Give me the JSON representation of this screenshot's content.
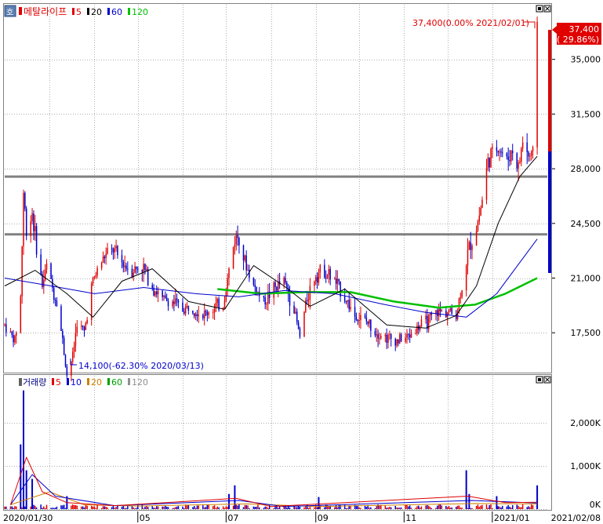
{
  "price_panel": {
    "icon_label": "호",
    "stock_name": "메탈라이프",
    "ma_legend": [
      {
        "label": "5",
        "color": "#e00000"
      },
      {
        "label": "20",
        "color": "#000000"
      },
      {
        "label": "60",
        "color": "#0000cc"
      },
      {
        "label": "120",
        "color": "#00c000"
      }
    ],
    "high_annotation": "37,400(0.00% 2021/02/01)",
    "low_annotation": "14,100(-62.30% 2020/03/13)",
    "current_price_label": "37,400",
    "current_change_label": "( 29.86%)",
    "y_ticks": [
      "35,000",
      "31,500",
      "28,000",
      "24,500",
      "21,000",
      "17,500"
    ]
  },
  "volume_panel": {
    "title": "거래량",
    "ma_legend": [
      {
        "label": "5",
        "color": "#e00000"
      },
      {
        "label": "10",
        "color": "#0000cc"
      },
      {
        "label": "20",
        "color": "#d08000"
      },
      {
        "label": "60",
        "color": "#00a000"
      },
      {
        "label": "120",
        "color": "#909090"
      }
    ],
    "y_ticks": [
      "2,000K",
      "1,000K",
      "0K"
    ]
  },
  "x_axis": {
    "labels": [
      "2020/01/30",
      "05",
      "07",
      "09",
      "11",
      "2021/01",
      "2021/02/08"
    ]
  },
  "colors": {
    "up": "#e00000",
    "down": "#0000cc",
    "ma5": "#e00000",
    "ma20": "#000000",
    "ma60": "#0000cc",
    "ma120": "#00c000",
    "grid": "#b0b0b0",
    "support_line": "#808080"
  },
  "chart_data": {
    "type": "candlestick",
    "x_start": "2020/01/30",
    "x_end": "2021/02/08",
    "ylim": [
      15000,
      38500
    ],
    "volume_ylim": [
      0,
      2800000
    ],
    "horizontal_lines": [
      27500,
      23800
    ],
    "price_path": [
      [
        "2020/01/30",
        18000
      ],
      [
        "2020/02/03",
        17400
      ],
      [
        "2020/02/06",
        17000
      ],
      [
        "2020/02/10",
        19800
      ],
      [
        "2020/02/12",
        26500
      ],
      [
        "2020/02/14",
        24000
      ],
      [
        "2020/02/18",
        25200
      ],
      [
        "2020/02/21",
        23000
      ],
      [
        "2020/02/25",
        20500
      ],
      [
        "2020/02/28",
        21800
      ],
      [
        "2020/03/04",
        20000
      ],
      [
        "2020/03/06",
        19500
      ],
      [
        "2020/03/10",
        17000
      ],
      [
        "2020/03/13",
        14800
      ],
      [
        "2020/03/17",
        16000
      ],
      [
        "2020/03/20",
        18200
      ],
      [
        "2020/03/25",
        17500
      ],
      [
        "2020/03/30",
        20500
      ],
      [
        "2020/04/03",
        21500
      ],
      [
        "2020/04/08",
        22400
      ],
      [
        "2020/04/14",
        22800
      ],
      [
        "2020/04/20",
        22000
      ],
      [
        "2020/04/27",
        21500
      ],
      [
        "2020/05/04",
        21800
      ],
      [
        "2020/05/11",
        20500
      ],
      [
        "2020/05/18",
        19600
      ],
      [
        "2020/05/25",
        19500
      ],
      [
        "2020/06/01",
        19000
      ],
      [
        "2020/06/08",
        19200
      ],
      [
        "2020/06/15",
        18600
      ],
      [
        "2020/06/22",
        19100
      ],
      [
        "2020/06/29",
        19300
      ],
      [
        "2020/07/03",
        21500
      ],
      [
        "2020/07/07",
        23500
      ],
      [
        "2020/07/10",
        23800
      ],
      [
        "2020/07/14",
        22000
      ],
      [
        "2020/07/20",
        20500
      ],
      [
        "2020/07/27",
        19500
      ],
      [
        "2020/08/03",
        20300
      ],
      [
        "2020/08/10",
        20800
      ],
      [
        "2020/08/17",
        19000
      ],
      [
        "2020/08/21",
        17200
      ],
      [
        "2020/08/26",
        19800
      ],
      [
        "2020/09/01",
        21300
      ],
      [
        "2020/09/07",
        21500
      ],
      [
        "2020/09/14",
        20800
      ],
      [
        "2020/09/21",
        19800
      ],
      [
        "2020/09/28",
        18600
      ],
      [
        "2020/10/06",
        18200
      ],
      [
        "2020/10/13",
        17600
      ],
      [
        "2020/10/20",
        17200
      ],
      [
        "2020/10/27",
        17000
      ],
      [
        "2020/11/03",
        17200
      ],
      [
        "2020/11/10",
        17800
      ],
      [
        "2020/11/17",
        18200
      ],
      [
        "2020/11/24",
        18800
      ],
      [
        "2020/12/01",
        18900
      ],
      [
        "2020/12/07",
        18600
      ],
      [
        "2020/12/11",
        20500
      ],
      [
        "2020/12/16",
        23000
      ],
      [
        "2020/12/21",
        24200
      ],
      [
        "2020/12/24",
        25500
      ],
      [
        "2020/12/29",
        28500
      ],
      [
        "2021/01/05",
        29500
      ],
      [
        "2021/01/11",
        28500
      ],
      [
        "2021/01/15",
        29200
      ],
      [
        "2021/01/19",
        28000
      ],
      [
        "2021/01/22",
        29800
      ],
      [
        "2021/01/26",
        28800
      ],
      [
        "2021/01/29",
        28800
      ],
      [
        "2021/02/01",
        37400
      ]
    ],
    "ma20": [
      [
        "2020/01/30",
        20500
      ],
      [
        "2020/02/20",
        21500
      ],
      [
        "2020/03/13",
        20000
      ],
      [
        "2020/03/31",
        18500
      ],
      [
        "2020/04/20",
        20800
      ],
      [
        "2020/05/11",
        21600
      ],
      [
        "2020/06/05",
        19500
      ],
      [
        "2020/06/30",
        19000
      ],
      [
        "2020/07/20",
        21800
      ],
      [
        "2020/08/10",
        20500
      ],
      [
        "2020/08/28",
        19200
      ],
      [
        "2020/09/21",
        20300
      ],
      [
        "2020/10/20",
        18000
      ],
      [
        "2020/11/16",
        17800
      ],
      [
        "2020/12/07",
        18600
      ],
      [
        "2020/12/21",
        20500
      ],
      [
        "2021/01/05",
        24500
      ],
      [
        "2021/01/20",
        27500
      ],
      [
        "2021/02/01",
        28800
      ]
    ],
    "ma60": [
      [
        "2020/01/30",
        21000
      ],
      [
        "2020/03/02",
        20500
      ],
      [
        "2020/04/01",
        20000
      ],
      [
        "2020/05/05",
        20400
      ],
      [
        "2020/06/10",
        20000
      ],
      [
        "2020/07/10",
        19800
      ],
      [
        "2020/08/10",
        20200
      ],
      [
        "2020/09/14",
        20000
      ],
      [
        "2020/10/19",
        19300
      ],
      [
        "2020/11/16",
        18800
      ],
      [
        "2020/12/14",
        18500
      ],
      [
        "2021/01/04",
        20000
      ],
      [
        "2021/02/01",
        23500
      ]
    ],
    "ma120": [
      [
        "2020/06/25",
        20300
      ],
      [
        "2020/07/25",
        20000
      ],
      [
        "2020/08/25",
        20100
      ],
      [
        "2020/09/25",
        20100
      ],
      [
        "2020/10/25",
        19500
      ],
      [
        "2020/11/25",
        19100
      ],
      [
        "2020/12/20",
        19300
      ],
      [
        "2021/01/10",
        20000
      ],
      [
        "2021/02/01",
        21000
      ]
    ],
    "volume_spikes": [
      [
        "2020/02/12",
        2750000
      ],
      [
        "2020/02/10",
        1500000
      ],
      [
        "2020/02/14",
        900000
      ],
      [
        "2020/02/18",
        700000
      ],
      [
        "2020/03/13",
        300000
      ],
      [
        "2020/07/07",
        550000
      ],
      [
        "2020/07/03",
        350000
      ],
      [
        "2020/09/03",
        280000
      ],
      [
        "2020/12/14",
        900000
      ],
      [
        "2020/12/16",
        350000
      ],
      [
        "2021/01/04",
        300000
      ],
      [
        "2021/02/01",
        550000
      ]
    ],
    "volume_ma5": [
      [
        "2020/02/03",
        100000
      ],
      [
        "2020/02/14",
        1200000
      ],
      [
        "2020/02/25",
        400000
      ],
      [
        "2020/03/13",
        150000
      ],
      [
        "2020/04/15",
        80000
      ],
      [
        "2020/07/08",
        250000
      ],
      [
        "2020/08/01",
        60000
      ],
      [
        "2020/12/15",
        300000
      ],
      [
        "2021/01/10",
        150000
      ],
      [
        "2021/02/01",
        160000
      ]
    ],
    "volume_ma10": [
      [
        "2020/02/03",
        100000
      ],
      [
        "2020/02/18",
        800000
      ],
      [
        "2020/03/05",
        300000
      ],
      [
        "2020/04/15",
        80000
      ],
      [
        "2020/07/10",
        200000
      ],
      [
        "2020/08/10",
        60000
      ],
      [
        "2020/12/18",
        200000
      ],
      [
        "2021/02/01",
        140000
      ]
    ],
    "volume_ma20": [
      [
        "2020/02/03",
        100000
      ],
      [
        "2020/03/01",
        400000
      ],
      [
        "2020/03/25",
        100000
      ],
      [
        "2020/05/01",
        70000
      ],
      [
        "2020/07/15",
        120000
      ],
      [
        "2020/09/01",
        60000
      ],
      [
        "2020/12/20",
        130000
      ],
      [
        "2021/02/01",
        120000
      ]
    ]
  }
}
